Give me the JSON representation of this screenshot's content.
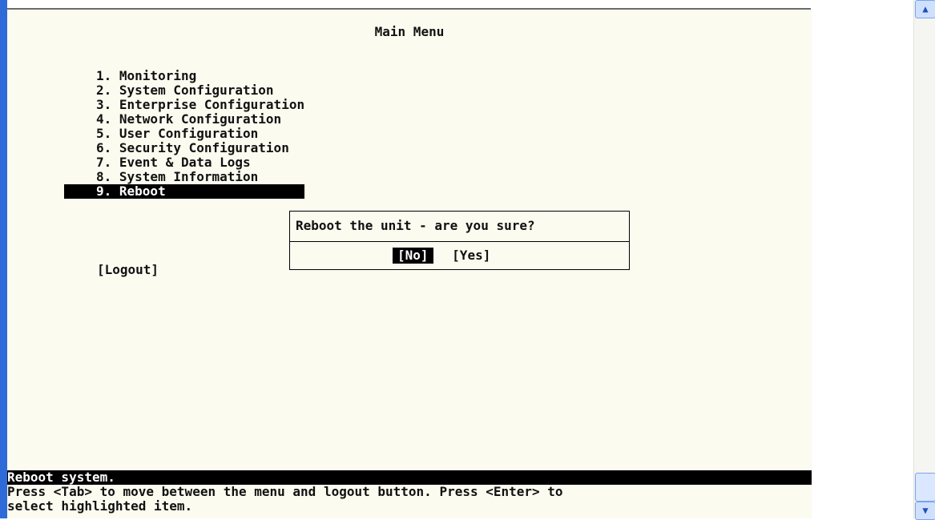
{
  "terminal": {
    "title": "Main Menu",
    "menu": [
      "1. Monitoring",
      "2. System Configuration",
      "3. Enterprise Configuration",
      "4. Network Configuration",
      "5. User Configuration",
      "6. Security Configuration",
      "7. Event & Data Logs",
      "8. System Information",
      "9. Reboot"
    ],
    "logout_label": "[Logout]",
    "dialog": {
      "message": "Reboot the unit - are you sure?",
      "no_label": "[No]",
      "yes_label": "[Yes]"
    },
    "status_text": "Reboot system.",
    "help_line_1": "Press <Tab> to move between the menu and logout button. Press <Enter> to",
    "help_line_2": "select highlighted item."
  },
  "ui_state": {
    "selected_menu_index": 8,
    "selected_dialog_button": "no"
  },
  "icons": {
    "scroll_up": "chevron-up-icon",
    "scroll_down": "chevron-down-icon"
  }
}
